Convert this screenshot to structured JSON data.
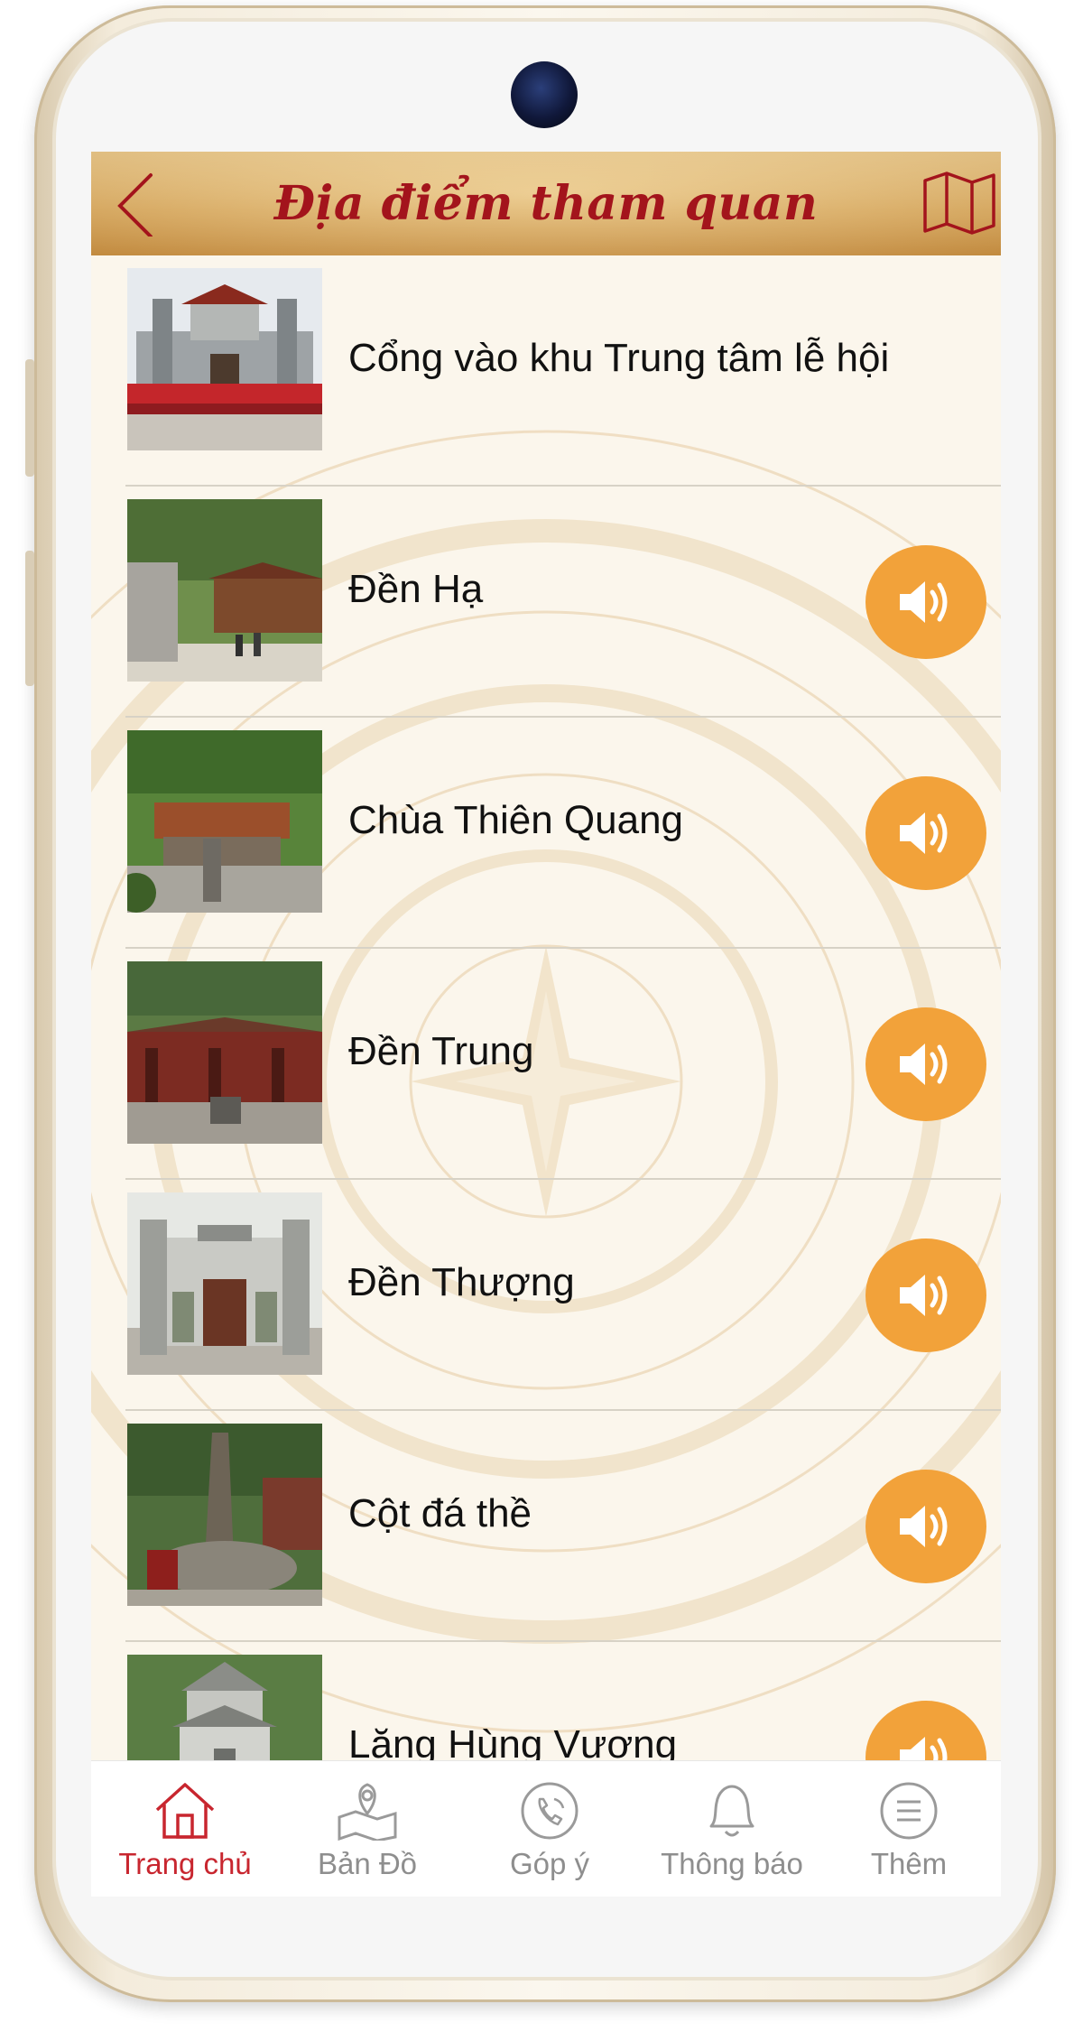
{
  "header": {
    "title": "Địa điểm tham quan"
  },
  "places": [
    {
      "name": "Cổng vào khu Trung tâm lễ hội",
      "has_audio": false
    },
    {
      "name": "Đền Hạ",
      "has_audio": true
    },
    {
      "name": "Chùa Thiên Quang",
      "has_audio": true
    },
    {
      "name": "Đền Trung",
      "has_audio": true
    },
    {
      "name": "Đền Thượng",
      "has_audio": true
    },
    {
      "name": "Cột đá thề",
      "has_audio": true
    },
    {
      "name": "Lăng Hùng Vương",
      "has_audio": true
    }
  ],
  "tabbar": {
    "items": [
      {
        "label": "Trang chủ",
        "icon": "home-icon",
        "active": true
      },
      {
        "label": "Bản Đồ",
        "icon": "map-pin-icon",
        "active": false
      },
      {
        "label": "Góp ý",
        "icon": "phone-icon",
        "active": false
      },
      {
        "label": "Thông báo",
        "icon": "bell-icon",
        "active": false
      },
      {
        "label": "Thêm",
        "icon": "menu-icon",
        "active": false
      }
    ]
  },
  "colors": {
    "accent": "#c8262f",
    "title": "#a3141c",
    "audio_button": "#f2a23a",
    "header": "#d9a95c",
    "inactive_tab": "#8e8e8e"
  }
}
